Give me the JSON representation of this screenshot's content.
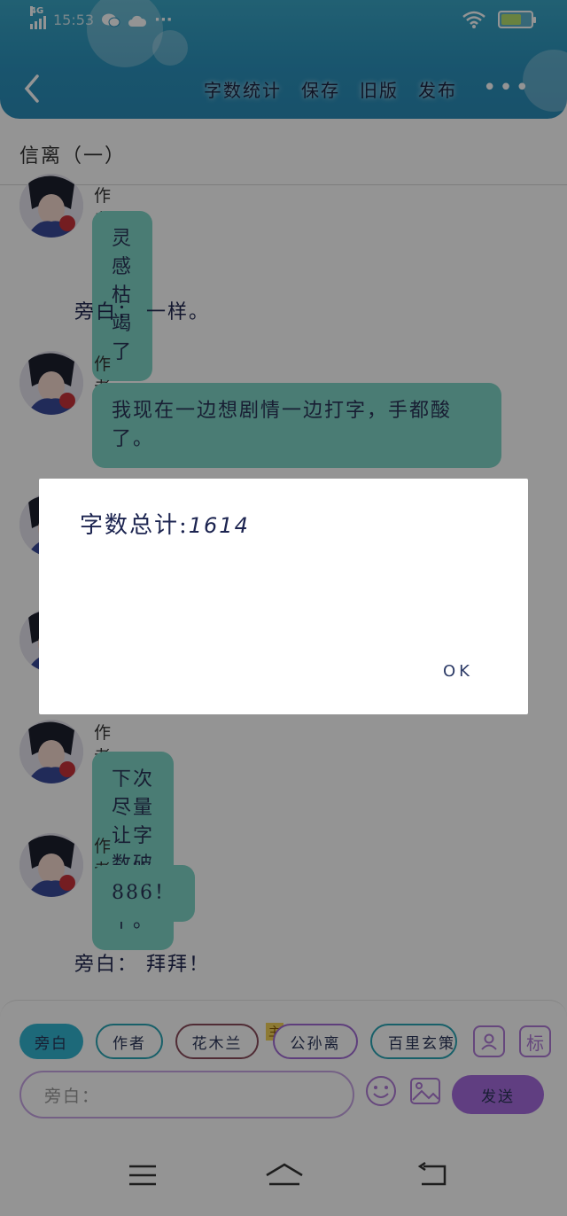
{
  "status_bar": {
    "network": "4G",
    "time": "15:53",
    "dots": "···"
  },
  "header": {
    "actions": [
      "字数统计",
      "保存",
      "旧版",
      "发布"
    ],
    "more": "•••"
  },
  "chapter_title": "信离（一）",
  "chat": {
    "messages": [
      {
        "type": "author",
        "name": "作者",
        "text": "灵感枯竭了"
      },
      {
        "type": "narration",
        "text": "旁白： 一样。"
      },
      {
        "type": "author",
        "name": "作者",
        "text": "我现在一边想剧情一边打字，手都酸了。"
      },
      {
        "type": "author",
        "name": "作者",
        "text": "下次尽量让字数破两千。"
      },
      {
        "type": "author",
        "name": "作者",
        "text": "886！"
      },
      {
        "type": "narration",
        "text": "旁白： 拜拜！"
      }
    ]
  },
  "role_chips": [
    "旁白",
    "作者",
    "花木兰",
    "公孙离",
    "百里玄策"
  ],
  "chip_badge": "主",
  "right_icons": {
    "user": "user-icon",
    "tag": "标"
  },
  "input": {
    "placeholder": "旁白："
  },
  "send_label": "发送",
  "dialog": {
    "title": "字数总计:",
    "value": "1614",
    "ok_label": "OK"
  },
  "colors": {
    "header": "#2b93bd",
    "bubble": "#80d6c8",
    "accent": "#a56bde"
  }
}
